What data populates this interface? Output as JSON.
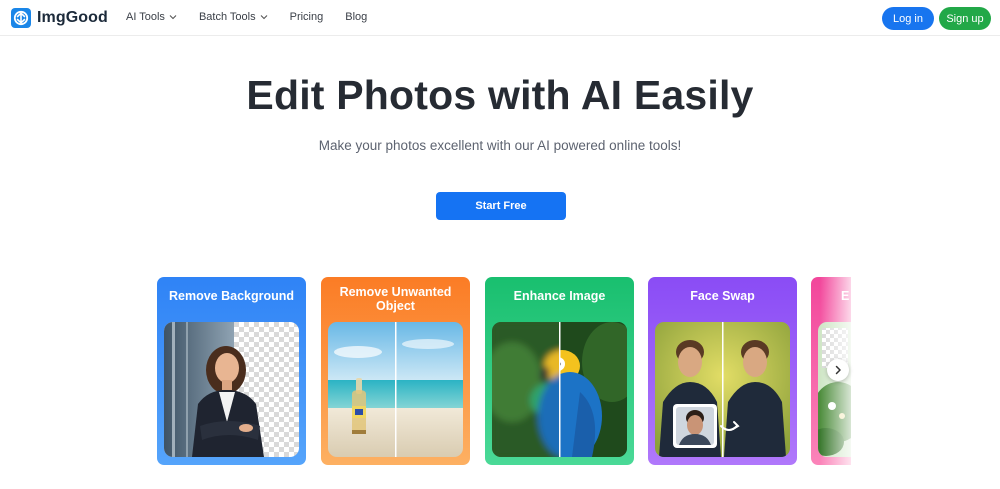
{
  "brand": {
    "name": "ImgGood"
  },
  "nav": {
    "items": [
      {
        "label": "AI Tools",
        "has_dropdown": true
      },
      {
        "label": "Batch Tools",
        "has_dropdown": true
      },
      {
        "label": "Pricing",
        "has_dropdown": false
      },
      {
        "label": "Blog",
        "has_dropdown": false
      }
    ]
  },
  "auth": {
    "login_label": "Log in",
    "signup_label": "Sign up"
  },
  "hero": {
    "title": "Edit Photos with AI Easily",
    "subtitle": "Make your photos excellent with our AI powered online tools!",
    "cta_label": "Start Free"
  },
  "tools": [
    {
      "title": "Remove Background",
      "color": "#2f83f6",
      "image": "portrait-of-woman-with-transparent-background"
    },
    {
      "title": "Remove Unwanted Object",
      "color": "#fb7c25",
      "image": "bottle-on-beach-before-after"
    },
    {
      "title": "Enhance Image",
      "color": "#19bf6f",
      "image": "parrot-blurry-vs-sharp"
    },
    {
      "title": "Face Swap",
      "color": "#8a4cf5",
      "image": "man-in-hoodie-face-swap"
    },
    {
      "title": "E",
      "color": "#f2469b",
      "image": "flowers-partially-visible"
    }
  ],
  "icons": {
    "logo": "imggood-logo-icon",
    "dropdown": "chevron-down-icon",
    "carousel_next": "chevron-right-icon"
  },
  "colors": {
    "primary": "#1573f3",
    "signup": "#22a848",
    "title_text": "#262b33"
  }
}
